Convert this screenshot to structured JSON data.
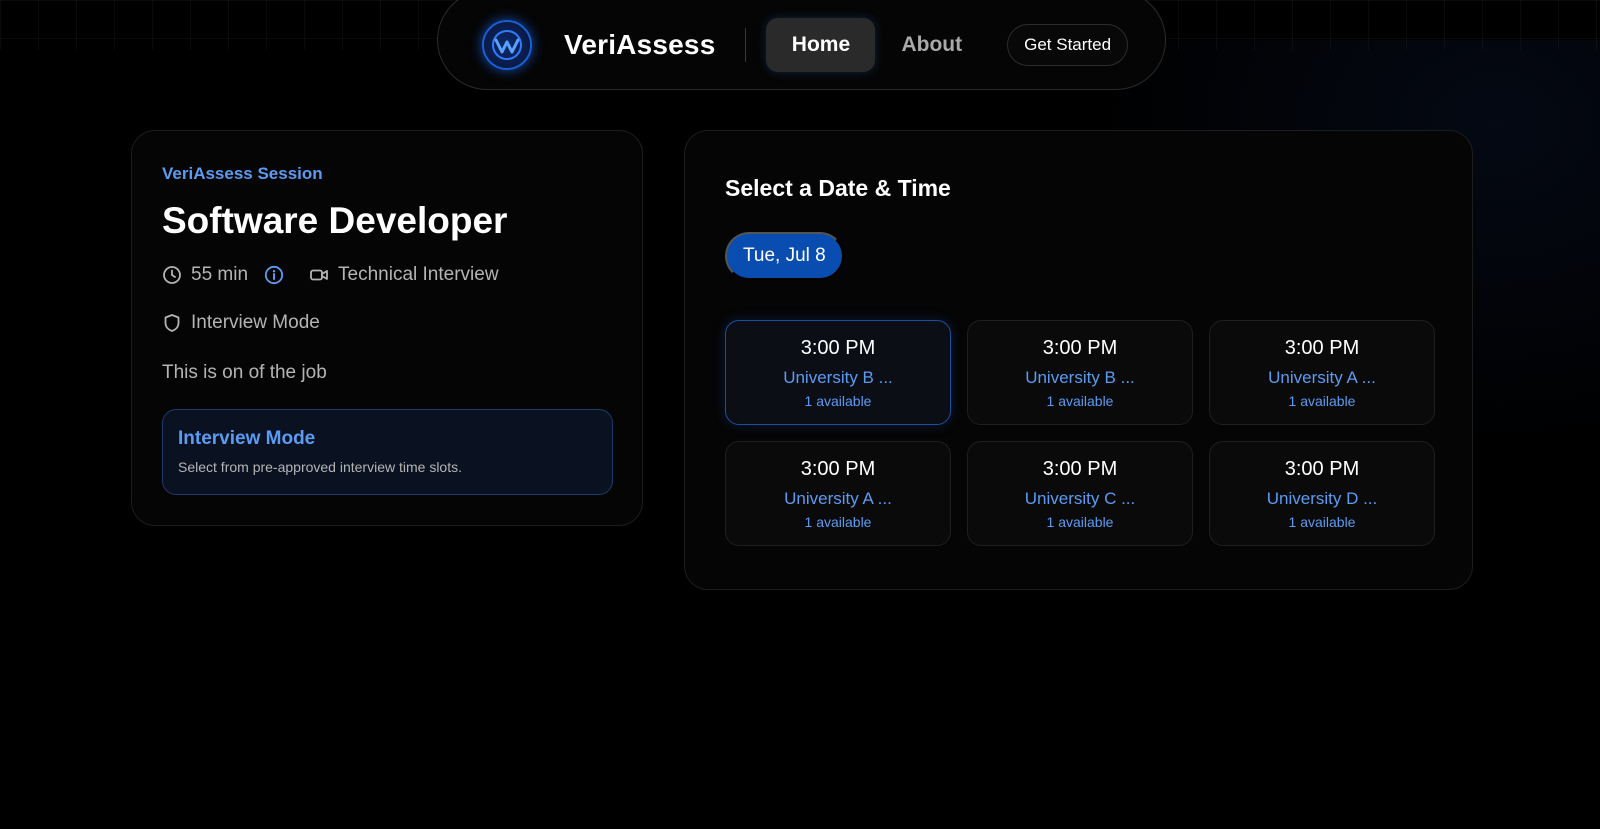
{
  "nav": {
    "brand": "VeriAssess",
    "home_label": "Home",
    "about_label": "About",
    "cta_label": "Get Started"
  },
  "session": {
    "label": "VeriAssess Session",
    "title": "Software Developer",
    "duration": "55 min",
    "type": "Technical Interview",
    "mode": "Interview Mode",
    "description": "This is on of the job",
    "mode_box": {
      "title": "Interview Mode",
      "subtitle": "Select from pre-approved interview time slots."
    }
  },
  "scheduler": {
    "title": "Select a Date & Time",
    "selected_date": "Tue, Jul 8",
    "slots": [
      {
        "time": "3:00 PM",
        "university": "University B ...",
        "availability": "1 available",
        "selected": true
      },
      {
        "time": "3:00 PM",
        "university": "University B ...",
        "availability": "1 available",
        "selected": false
      },
      {
        "time": "3:00 PM",
        "university": "University A ...",
        "availability": "1 available",
        "selected": false
      },
      {
        "time": "3:00 PM",
        "university": "University A ...",
        "availability": "1 available",
        "selected": false
      },
      {
        "time": "3:00 PM",
        "university": "University C ...",
        "availability": "1 available",
        "selected": false
      },
      {
        "time": "3:00 PM",
        "university": "University D ...",
        "availability": "1 available",
        "selected": false
      }
    ]
  },
  "icons": {
    "logo": "veriassess-logo",
    "duration": "clock-icon",
    "info": "info-icon",
    "type": "video-camera-icon",
    "mode": "shield-icon"
  },
  "colors": {
    "background": "#000000",
    "accent": "#5b9bf2",
    "primary": "#0a4db0",
    "text_muted": "#b4b4b4"
  }
}
